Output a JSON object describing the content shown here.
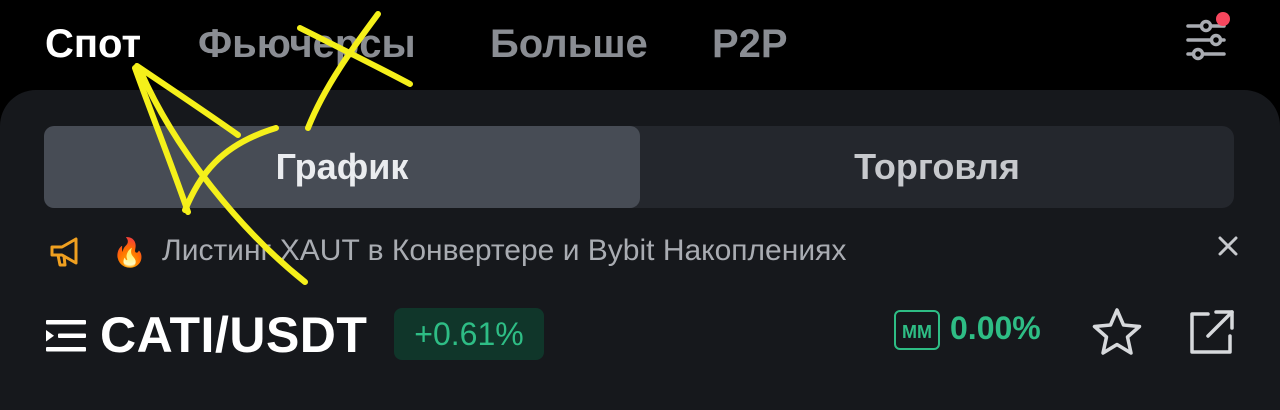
{
  "top_nav": {
    "tabs": [
      {
        "label": "Спот",
        "active": true
      },
      {
        "label": "Фьючерсы",
        "active": false
      },
      {
        "label": "Больше",
        "active": false
      },
      {
        "label": "P2P",
        "active": false
      }
    ],
    "filter_icon": "sliders-icon",
    "notification_dot_color": "#f6465d"
  },
  "segment": {
    "chart_label": "График",
    "trade_label": "Торговля",
    "active": "chart"
  },
  "announcement": {
    "icon": "megaphone-icon",
    "emoji": "🔥",
    "text": "Листинг XAUT в Конвертере и Bybit  Накоплениях"
  },
  "ticker": {
    "pair": "CATI/USDT",
    "change": "+0.61%",
    "mm_label": "MM",
    "mm_value": "0.00%"
  },
  "colors": {
    "accent_green": "#2ebd85",
    "annotation_yellow": "#f5f01a",
    "background": "#000000",
    "panel": "#16181c"
  }
}
